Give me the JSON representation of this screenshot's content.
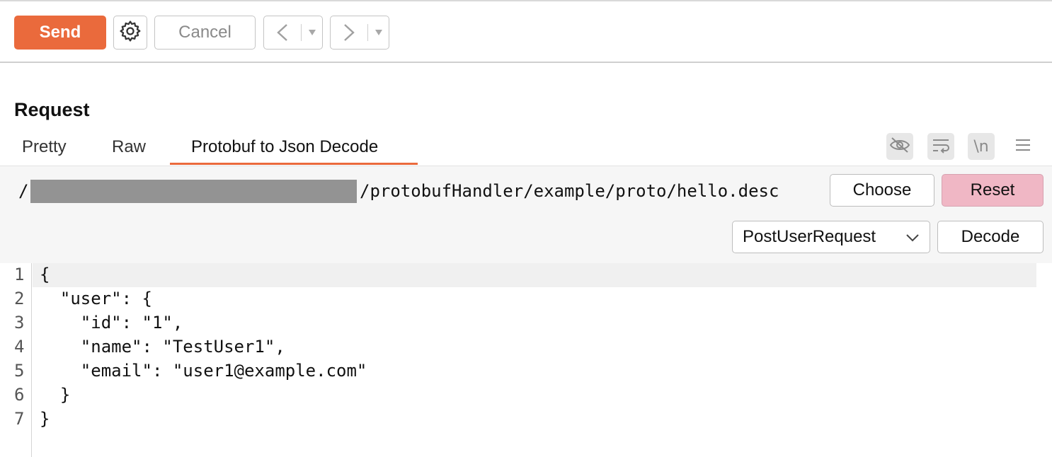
{
  "toolbar": {
    "send_label": "Send",
    "cancel_label": "Cancel",
    "back_icon": "chevron-left-icon",
    "forward_icon": "chevron-right-icon",
    "dropdown_icon": "caret-down-icon",
    "settings_icon": "gear-icon"
  },
  "request": {
    "title": "Request",
    "tabs": [
      {
        "label": "Pretty",
        "active": false
      },
      {
        "label": "Raw",
        "active": false
      },
      {
        "label": "Protobuf to Json Decode",
        "active": true
      }
    ],
    "tool_icons": [
      "eye-off-icon",
      "wrap-lines-icon",
      "newline-icon",
      "menu-icon"
    ],
    "newline_label": "\\n"
  },
  "decoder": {
    "path_prefix": "/",
    "path_suffix": "/protobufHandler/example/proto/hello.desc",
    "choose_label": "Choose",
    "reset_label": "Reset",
    "message_type": "PostUserRequest",
    "decode_label": "Decode"
  },
  "editor": {
    "lines": [
      {
        "n": "1",
        "text": "{"
      },
      {
        "n": "2",
        "text": "  \"user\": {"
      },
      {
        "n": "3",
        "text": "    \"id\": \"1\","
      },
      {
        "n": "4",
        "text": "    \"name\": \"TestUser1\","
      },
      {
        "n": "5",
        "text": "    \"email\": \"user1@example.com\""
      },
      {
        "n": "6",
        "text": "  }"
      },
      {
        "n": "7",
        "text": "}"
      }
    ]
  },
  "colors": {
    "accent": "#ea6a3c",
    "reset_bg": "#f0b7c5",
    "redacted": "#939393"
  }
}
